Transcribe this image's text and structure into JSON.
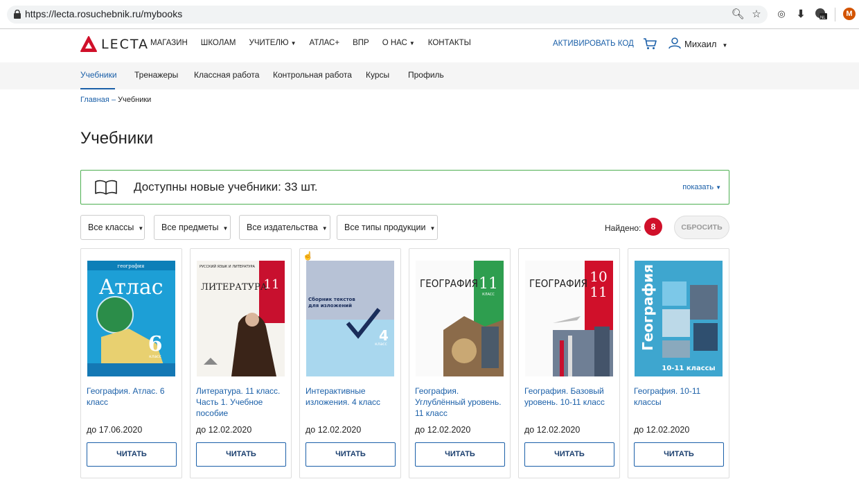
{
  "browser": {
    "url": "https://lecta.rosuchebnik.ru/mybooks",
    "profile_initial": "M"
  },
  "header": {
    "logo_text": "LECTA",
    "nav": [
      {
        "label": "МАГАЗИН"
      },
      {
        "label": "ШКОЛАМ"
      },
      {
        "label": "УЧИТЕЛЮ",
        "has_caret": true
      },
      {
        "label": "АТЛАС+"
      },
      {
        "label": "ВПР"
      },
      {
        "label": "О НАС",
        "has_caret": true
      },
      {
        "label": "КОНТАКТЫ"
      }
    ],
    "activate_label": "АКТИВИРОВАТЬ КОД",
    "user_name": "Михаил"
  },
  "subnav": {
    "tabs": [
      "Учебники",
      "Тренажеры",
      "Классная работа",
      "Контрольная работа",
      "Курсы",
      "Профиль"
    ],
    "active": "Учебники"
  },
  "breadcrumb": {
    "home": "Главная",
    "separator": "–",
    "current": "Учебники"
  },
  "page_title": "Учебники",
  "banner": {
    "text": "Доступны новые учебники: 33 шт.",
    "show_label": "показать"
  },
  "filters": [
    "Все классы",
    "Все предметы",
    "Все издательства",
    "Все типы продукции"
  ],
  "found": {
    "label": "Найдено:",
    "count": "8"
  },
  "reset_label": "СБРОСИТЬ",
  "books": [
    {
      "title": "География. Атлас. 6 класс",
      "date": "до 17.06.2020",
      "button": "ЧИТАТЬ",
      "cover_text": [
        "география",
        "Атлас",
        "6",
        "класс"
      ]
    },
    {
      "title": "Литература. 11 класс. Часть 1. Учебное пособие",
      "date": "до 12.02.2020",
      "button": "ЧИТАТЬ",
      "cover_text": [
        "РУССКИЙ ЯЗЫК И ЛИТЕРАТУРА",
        "ЛИТЕРАТУРА",
        "11"
      ]
    },
    {
      "title": "Интерактивные изложения. 4 класс",
      "date": "до 12.02.2020",
      "button": "ЧИТАТЬ",
      "cover_text": [
        "Сборник текстов",
        "для изложений",
        "4",
        "класс"
      ]
    },
    {
      "title": "География. Углублённый уровень. 11 класс",
      "date": "до 12.02.2020",
      "button": "ЧИТАТЬ",
      "cover_text": [
        "ГЕОГРАФИЯ",
        "11",
        "КЛАСС"
      ]
    },
    {
      "title": "География. Базовый уровень. 10-11 класс",
      "date": "до 12.02.2020",
      "button": "ЧИТАТЬ",
      "cover_text": [
        "ГЕОГРАФИЯ",
        "10",
        "11"
      ]
    },
    {
      "title": "География. 10-11 классы",
      "date": "до 12.02.2020",
      "button": "ЧИТАТЬ",
      "cover_text": [
        "География",
        "10-11 классы"
      ]
    }
  ],
  "colors": {
    "accent": "#1a5fa8",
    "badge": "#d0102a",
    "banner_border": "#4caf50",
    "logo": "#d0102a"
  }
}
